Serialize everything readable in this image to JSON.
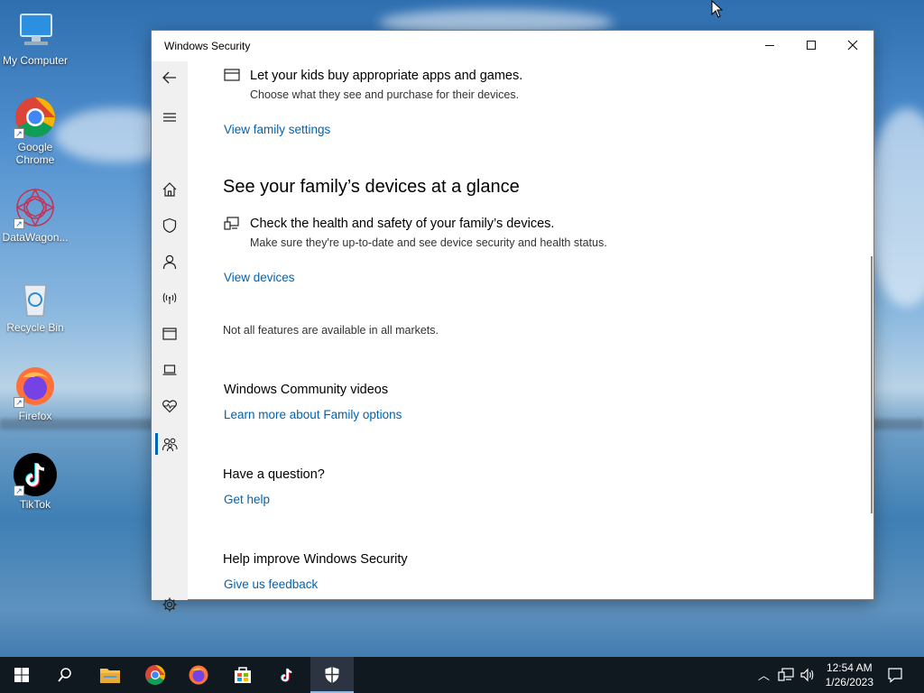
{
  "desktop": {
    "icons": [
      {
        "label": "My Computer",
        "icon": "monitor-icon"
      },
      {
        "label": "Google Chrome",
        "icon": "chrome-icon"
      },
      {
        "label": "DataWagon...",
        "icon": "datawagon-icon"
      },
      {
        "label": "Recycle Bin",
        "icon": "recycle-bin-icon"
      },
      {
        "label": "Firefox",
        "icon": "firefox-icon"
      },
      {
        "label": "TikTok",
        "icon": "tiktok-icon"
      }
    ]
  },
  "window": {
    "title": "Windows Security",
    "nav_items": [
      "back-arrow-icon",
      "menu-icon",
      "home-icon",
      "shield-icon",
      "person-icon",
      "wireless-icon",
      "app-browser-icon",
      "laptop-icon",
      "heart-pulse-icon",
      "family-icon",
      "gear-icon"
    ],
    "content": {
      "apps_row": {
        "title": "Let your kids buy appropriate apps and games.",
        "subtitle": "Choose what they see and purchase for their devices."
      },
      "view_family_link": "View family settings",
      "devices_heading": "See your family’s devices at a glance",
      "devices_row": {
        "title": "Check the health and safety of your family’s devices.",
        "subtitle": "Make sure they're up-to-date and see device security and health status."
      },
      "view_devices_link": "View devices",
      "markets_note": "Not all features are available in all markets.",
      "community": {
        "heading": "Windows Community videos",
        "link": "Learn more about Family options"
      },
      "question": {
        "heading": "Have a question?",
        "link": "Get help"
      },
      "improve": {
        "heading": "Help improve Windows Security",
        "link": "Give us feedback"
      }
    }
  },
  "taskbar": {
    "items": [
      "start-icon",
      "search-icon",
      "file-explorer-icon",
      "chrome-icon",
      "firefox-icon",
      "store-icon",
      "tiktok-icon",
      "windows-security-icon"
    ],
    "time": "12:54 AM",
    "date": "1/26/2023"
  },
  "colors": {
    "link": "#0063b1",
    "accent": "#0067b8",
    "taskbar": "#101820"
  }
}
